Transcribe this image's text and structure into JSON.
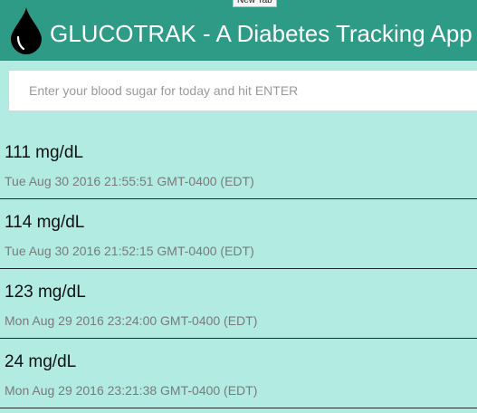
{
  "tooltip": "New Tab",
  "header": {
    "title": "GLUCOTRAK - A Diabetes Tracking App",
    "logo_icon": "drop-icon",
    "bg_color": "#2e9b86"
  },
  "entry_input": {
    "placeholder": "Enter your blood sugar for today and hit ENTER",
    "value": ""
  },
  "readings": [
    {
      "value": "111 mg/dL",
      "timestamp": "Tue Aug 30 2016 21:55:51 GMT-0400 (EDT)"
    },
    {
      "value": "114 mg/dL",
      "timestamp": "Tue Aug 30 2016 21:52:15 GMT-0400 (EDT)"
    },
    {
      "value": "123 mg/dL",
      "timestamp": "Mon Aug 29 2016 23:24:00 GMT-0400 (EDT)"
    },
    {
      "value": "24 mg/dL",
      "timestamp": "Mon Aug 29 2016 23:21:38 GMT-0400 (EDT)"
    }
  ],
  "colors": {
    "page_bg": "#b2ebe1",
    "header_bg": "#2e9b86"
  }
}
